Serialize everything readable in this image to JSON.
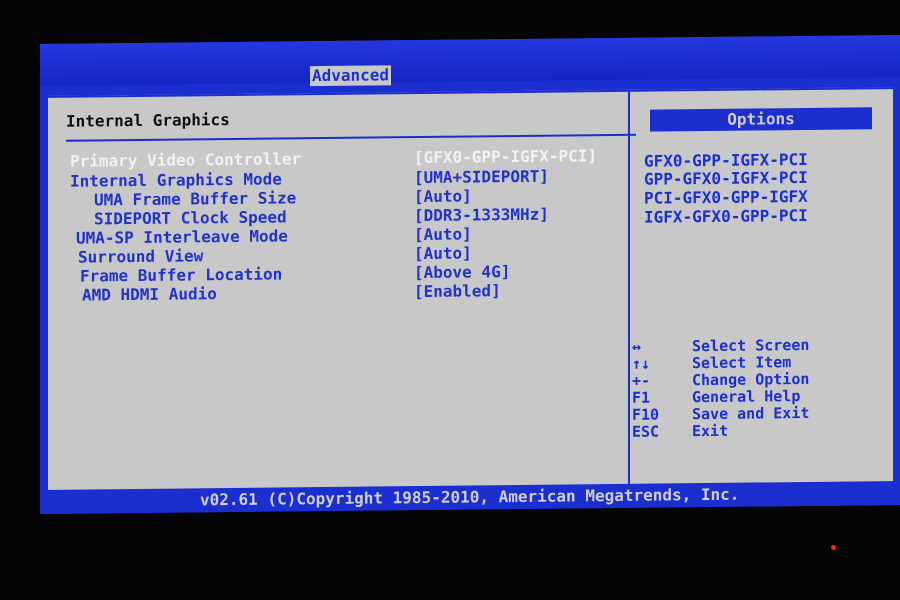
{
  "header": {
    "tab_label": "Advanced"
  },
  "main": {
    "title": "Internal Graphics",
    "settings": [
      {
        "label": "Primary Video Controller",
        "value": "[GFX0-GPP-IGFX-PCI]"
      },
      {
        "label": "Internal Graphics Mode",
        "value": "[UMA+SIDEPORT]"
      },
      {
        "label": "UMA Frame Buffer Size",
        "value": "[Auto]"
      },
      {
        "label": "SIDEPORT Clock Speed",
        "value": "[DDR3-1333MHz]"
      },
      {
        "label": "UMA-SP Interleave Mode",
        "value": "[Auto]"
      },
      {
        "label": "Surround View",
        "value": "[Auto]"
      },
      {
        "label": "Frame Buffer Location",
        "value": "[Above 4G]"
      },
      {
        "label": "AMD HDMI Audio",
        "value": "[Enabled]"
      }
    ]
  },
  "side": {
    "options_header": "Options",
    "options": [
      "GFX0-GPP-IGFX-PCI",
      "GPP-GFX0-IGFX-PCI",
      "PCI-GFX0-GPP-IGFX",
      "IGFX-GFX0-GPP-PCI"
    ],
    "help": [
      {
        "key": "↔",
        "desc": "Select Screen"
      },
      {
        "key": "↑↓",
        "desc": "Select Item"
      },
      {
        "key": "+-",
        "desc": "Change Option"
      },
      {
        "key": "F1",
        "desc": "General Help"
      },
      {
        "key": "F10",
        "desc": "Save and Exit"
      },
      {
        "key": "ESC",
        "desc": "Exit"
      }
    ]
  },
  "footer": {
    "copyright": "v02.61 (C)Copyright 1985-2010, American Megatrends, Inc."
  },
  "colors": {
    "bios_blue": "#1b2fd0",
    "panel_grey": "#c8c8c8",
    "selected_text": "#f2f2f2"
  }
}
